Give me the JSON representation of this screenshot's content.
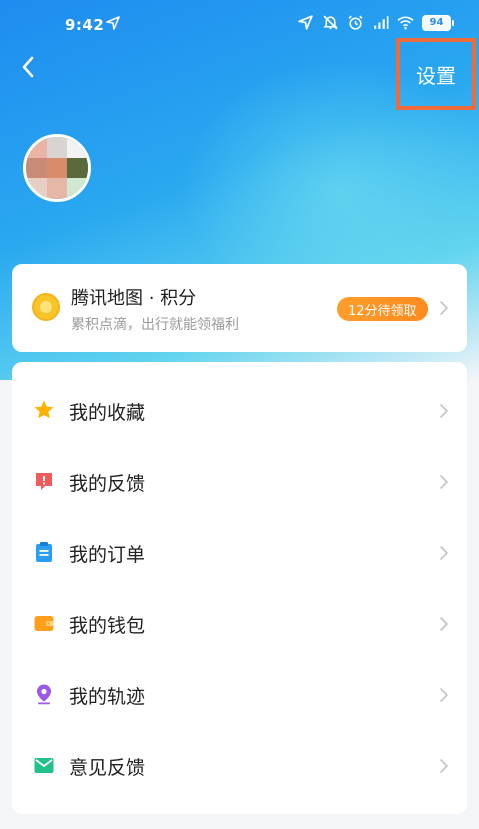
{
  "status_bar": {
    "time": "9:42",
    "battery": "94"
  },
  "header": {
    "settings_label": "设置"
  },
  "points_card": {
    "title": "腾讯地图 · 积分",
    "subtitle": "累积点滴，出行就能领福利",
    "badge": "12分待领取"
  },
  "menu": {
    "items": [
      {
        "label": "我的收藏",
        "icon": "star-icon"
      },
      {
        "label": "我的反馈",
        "icon": "feedback-alert-icon"
      },
      {
        "label": "我的订单",
        "icon": "clipboard-icon"
      },
      {
        "label": "我的钱包",
        "icon": "wallet-icon"
      },
      {
        "label": "我的轨迹",
        "icon": "location-pin-icon"
      },
      {
        "label": "意见反馈",
        "icon": "envelope-icon"
      }
    ]
  },
  "colors": {
    "header_blue": "#1e8cf0",
    "header_cyan": "#5fd3ef",
    "highlight_border": "#f06a3a",
    "badge_orange": "#ff8a1e"
  }
}
